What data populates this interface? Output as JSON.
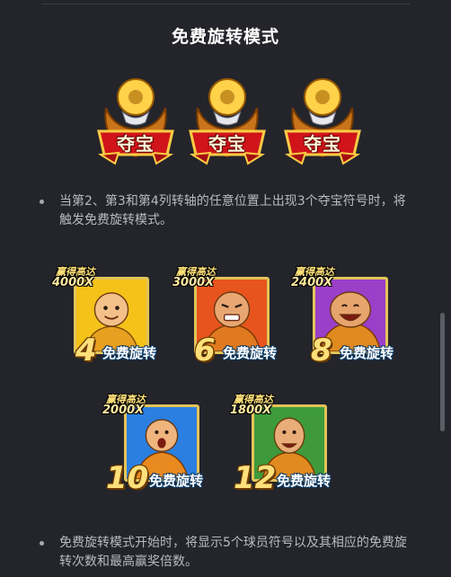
{
  "title": "免费旋转模式",
  "treasure": {
    "label": "夺宝",
    "count": 3
  },
  "bullets": [
    "当第2、第3和第4列转轴的任意位置上出现3个夺宝符号时，将触发免费旋转模式。",
    "免费旋转模式开始时，将显示5个球员符号以及其相应的免费旋转次数和最高赢奖倍数。"
  ],
  "cards": [
    {
      "win_label": "赢得高达",
      "multiplier": "4000X",
      "spins": "4",
      "spins_label": "免费旋转",
      "bg": "#f5c21a",
      "skin": "#f4c08a"
    },
    {
      "win_label": "赢得高达",
      "multiplier": "3000X",
      "spins": "6",
      "spins_label": "免费旋转",
      "bg": "#e8541e",
      "skin": "#e8a772"
    },
    {
      "win_label": "赢得高达",
      "multiplier": "2400X",
      "spins": "8",
      "spins_label": "免费旋转",
      "bg": "#9a3fc8",
      "skin": "#e7a46c"
    },
    {
      "win_label": "赢得高达",
      "multiplier": "2000X",
      "spins": "10",
      "spins_label": "免费旋转",
      "bg": "#2a7fe0",
      "skin": "#f0b57e"
    },
    {
      "win_label": "赢得高达",
      "multiplier": "1800X",
      "spins": "12",
      "spins_label": "免费旋转",
      "bg": "#3e9a3a",
      "skin": "#e9ad78"
    }
  ],
  "colors": {
    "background": "#24242b",
    "gold": "#e3c458",
    "bullet_text": "#b9b9c2"
  }
}
